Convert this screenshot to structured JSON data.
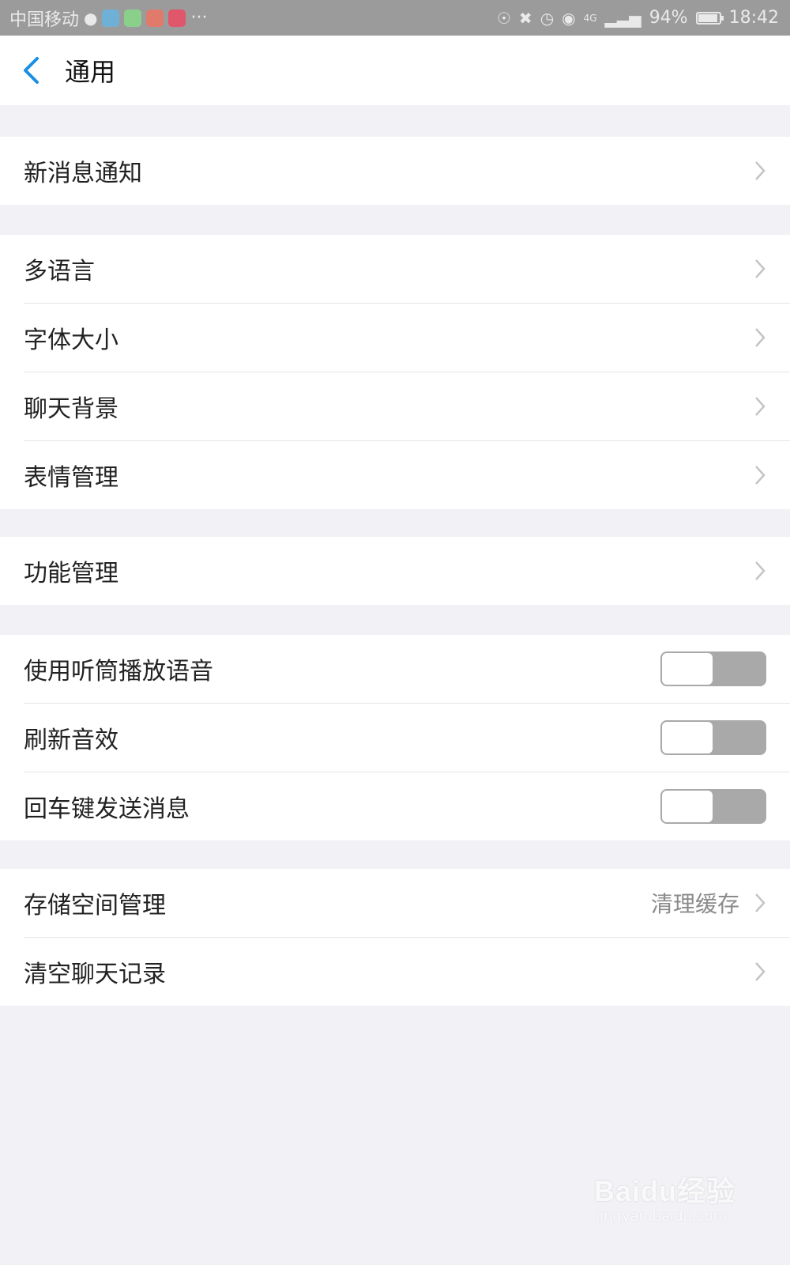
{
  "status_bar": {
    "carrier": "中国移动",
    "battery": "94%",
    "time": "18:42",
    "network": "4G",
    "more": "···"
  },
  "nav": {
    "title": "通用",
    "back_icon": "chevron-left-icon",
    "accent_color": "#1a8fe3"
  },
  "groups": [
    {
      "rows": [
        {
          "label": "新消息通知",
          "type": "link"
        }
      ]
    },
    {
      "rows": [
        {
          "label": "多语言",
          "type": "link"
        },
        {
          "label": "字体大小",
          "type": "link"
        },
        {
          "label": "聊天背景",
          "type": "link"
        },
        {
          "label": "表情管理",
          "type": "link"
        }
      ]
    },
    {
      "rows": [
        {
          "label": "功能管理",
          "type": "link"
        }
      ]
    },
    {
      "rows": [
        {
          "label": "使用听筒播放语音",
          "type": "toggle",
          "on": false
        },
        {
          "label": "刷新音效",
          "type": "toggle",
          "on": false
        },
        {
          "label": "回车键发送消息",
          "type": "toggle",
          "on": false
        }
      ]
    },
    {
      "rows": [
        {
          "label": "存储空间管理",
          "type": "link",
          "value": "清理缓存"
        },
        {
          "label": "清空聊天记录",
          "type": "link"
        }
      ]
    }
  ],
  "watermark": {
    "brand": "Baidu经验",
    "url": "jingyan.baidu.com"
  }
}
